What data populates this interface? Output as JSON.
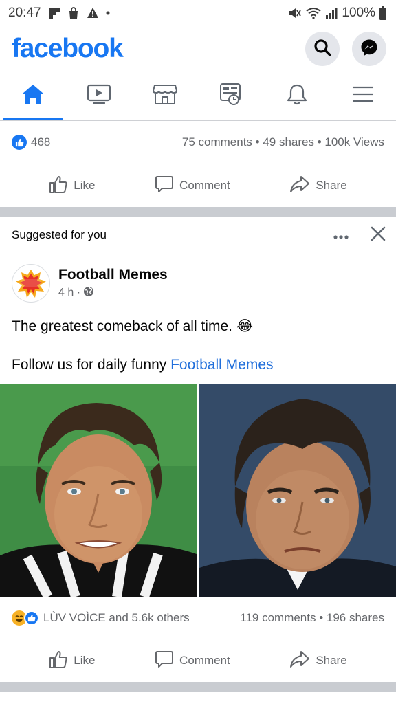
{
  "status_bar": {
    "time": "20:47",
    "battery": "100%"
  },
  "header": {
    "logo": "facebook"
  },
  "nav": {
    "tabs": [
      "home",
      "watch",
      "marketplace",
      "news-feed",
      "notifications",
      "menu"
    ]
  },
  "post1": {
    "reaction_count": "468",
    "stats": "75 comments • 49 shares • 100k Views",
    "actions": {
      "like": "Like",
      "comment": "Comment",
      "share": "Share"
    }
  },
  "suggested": {
    "label": "Suggested for you"
  },
  "post2": {
    "page_name": "Football Memes",
    "time": "4 h ·",
    "avatar_text": "FOOTBALL MEMES",
    "text_line1": "The greatest comeback of all time. 😂",
    "text_line2_prefix": "Follow us for daily funny ",
    "text_line2_link": "Football Memes",
    "reactions": "LÙV VOÌCE and 5.6k others",
    "stats": "119 comments • 196 shares",
    "actions": {
      "like": "Like",
      "comment": "Comment",
      "share": "Share"
    }
  },
  "colors": {
    "brand": "#1877f2",
    "secondary_text": "#65676b",
    "link": "#216fdb",
    "separator": "#c9ccd1"
  }
}
